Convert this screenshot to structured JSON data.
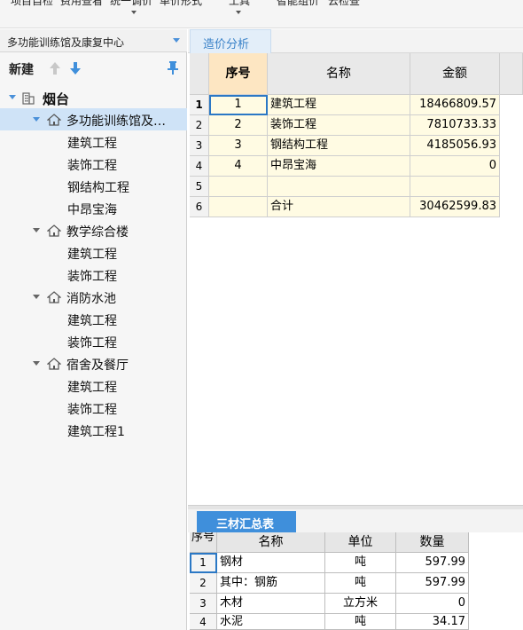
{
  "toolbar": {
    "items": [
      "项目自检",
      "费用查看",
      "统一调价",
      "单价形式",
      "工具",
      "智能组价",
      "云检查"
    ]
  },
  "project": {
    "selected": "多功能训练馆及康复中心"
  },
  "left": {
    "new_label": "新建"
  },
  "tree": {
    "root": "烟台",
    "units": [
      {
        "name": "多功能训练馆及…",
        "children": [
          "建筑工程",
          "装饰工程",
          "钢结构工程",
          "中昂宝海"
        ]
      },
      {
        "name": "教学综合楼",
        "children": [
          "建筑工程",
          "装饰工程"
        ]
      },
      {
        "name": "消防水池",
        "children": [
          "建筑工程",
          "装饰工程"
        ]
      },
      {
        "name": "宿舍及餐厅",
        "children": [
          "建筑工程",
          "装饰工程",
          "建筑工程1"
        ]
      }
    ]
  },
  "tabs": {
    "analysis": "造价分析"
  },
  "cost_table": {
    "headers": {
      "seq": "序号",
      "name": "名称",
      "amount": "金额"
    },
    "rows": [
      {
        "row": "1",
        "seq": "1",
        "name": "建筑工程",
        "amount": "18466809.57"
      },
      {
        "row": "2",
        "seq": "2",
        "name": "装饰工程",
        "amount": "7810733.33"
      },
      {
        "row": "3",
        "seq": "3",
        "name": "钢结构工程",
        "amount": "4185056.93"
      },
      {
        "row": "4",
        "seq": "4",
        "name": "中昂宝海",
        "amount": "0"
      },
      {
        "row": "5",
        "seq": "",
        "name": "",
        "amount": ""
      },
      {
        "row": "6",
        "seq": "",
        "name": "合计",
        "amount": "30462599.83"
      }
    ]
  },
  "materials": {
    "tab": "三材汇总表",
    "headers": {
      "seq": "序号",
      "name": "名称",
      "unit": "单位",
      "qty": "数量"
    },
    "rows": [
      {
        "row": "1",
        "name": "钢材",
        "unit": "吨",
        "qty": "597.99"
      },
      {
        "row": "2",
        "name": "其中：钢筋",
        "unit": "吨",
        "qty": "597.99"
      },
      {
        "row": "3",
        "name": "木材",
        "unit": "立方米",
        "qty": "0"
      },
      {
        "row": "4",
        "name": "水泥",
        "unit": "吨",
        "qty": "34.17"
      }
    ]
  },
  "colors": {
    "accent": "#3f8fdb",
    "selected_row": "#cfe3f7",
    "yellow_cell": "#fffbe3"
  }
}
